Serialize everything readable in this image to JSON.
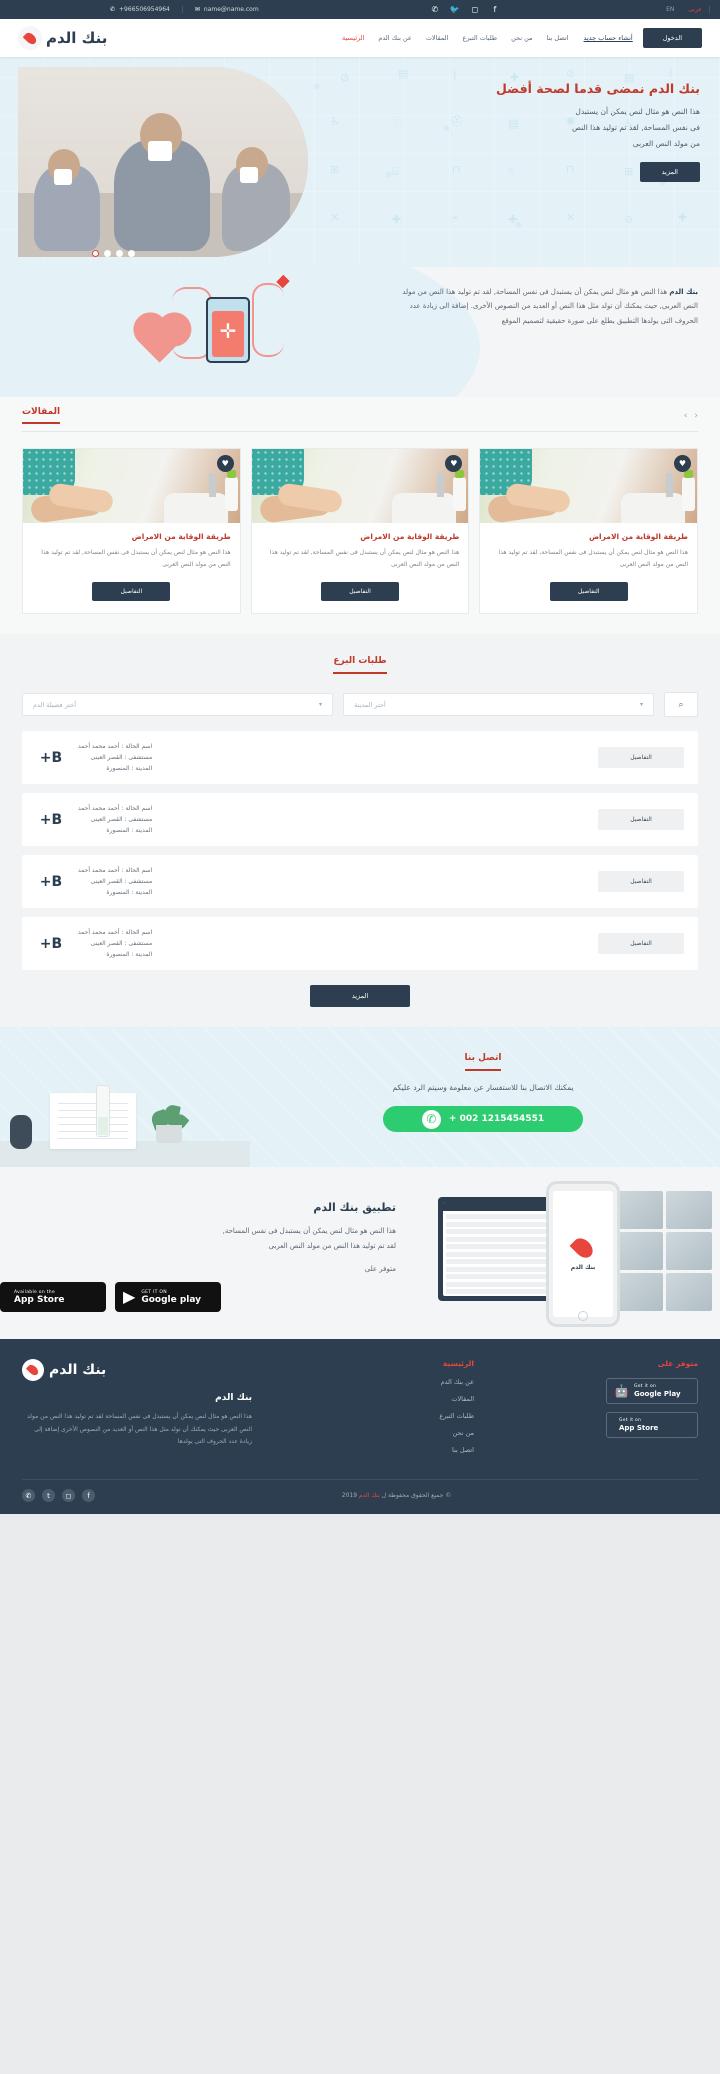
{
  "topbar": {
    "phone": "+966506954964",
    "email": "name@name.com",
    "phone_icon": "phone-icon",
    "email_icon": "envelope-icon",
    "social": [
      "whatsapp-icon",
      "twitter-icon",
      "instagram-icon",
      "facebook-icon"
    ],
    "lang_en": "EN",
    "lang_ar": "عربى"
  },
  "nav": {
    "brand": "بنك الدم",
    "links": [
      {
        "label": "الرئيسية",
        "active": true
      },
      {
        "label": "عن بنك الدم",
        "active": false
      },
      {
        "label": "المقالات",
        "active": false
      },
      {
        "label": "طلبات التبرع",
        "active": false
      },
      {
        "label": "من نحن",
        "active": false
      },
      {
        "label": "اتصل بنا",
        "active": false
      }
    ],
    "register": "أنشاء حساب جديد",
    "login": "الدخول"
  },
  "hero": {
    "title": "بنك الدم نمضى قدما لصحة أفضل",
    "line1": "هذا النص هو مثال لنص يمكن أن يستبدل",
    "line2": "فى نفس المساحة, لقد تم توليد هذا النص",
    "line3": "من مولد النص العربى",
    "button": "المزيد",
    "slides": 4,
    "active_slide": 4
  },
  "about": {
    "strong": "بنك الدم",
    "text": " هذا النص هو مثال لنص يمكن أن يستبدل فى نفس المساحة, لقد تم توليد هذا النص من مولد النص العربى, حيث يمكنك أن تولد مثل هذا النص أو العديد من النصوص الأخرى. إضافة الى زيادة عدد الحروف التى يولدها التطبيق يطلع على صورة حقيقية لتصميم الموقع"
  },
  "articles": {
    "section_title": "المقالات",
    "prev_icon": "chevron-left-icon",
    "next_icon": "chevron-right-icon",
    "items": [
      {
        "title": "طريقة الوقاية من الامراض",
        "text": "هذا النص هو مثال لنص يمكن أن يستبدل فى نفس المساحة, لقد تم توليد هذا النص من مولد النص العربى",
        "button": "التفاصيل",
        "favorite_icon": "heart-icon"
      },
      {
        "title": "طريقة الوقاية من الامراض",
        "text": "هذا النص هو مثال لنص يمكن أن يستبدل فى نفس المساحة, لقد تم توليد هذا النص من مولد النص العربى",
        "button": "التفاصيل",
        "favorite_icon": "heart-icon"
      },
      {
        "title": "طريقة الوقاية من الامراض",
        "text": "هذا النص هو مثال لنص يمكن أن يستبدل فى نفس المساحة, لقد تم توليد هذا النص من مولد النص العربى",
        "button": "التفاصيل",
        "favorite_icon": "heart-icon"
      }
    ]
  },
  "donations": {
    "section_title": "طلبات البرع",
    "filter_blood": "أختر فصيلة الدم",
    "filter_city": "أختر المدينة",
    "search_icon": "search-icon",
    "chevron_icon": "chevron-down-icon",
    "rows": [
      {
        "blood_type": "B+",
        "name": "اسم الحالة : أحمد محمد أحمد",
        "hospital": "مستشفى : القصر العينى",
        "city": "المدينة : المنصورة",
        "button": "التفاصيل"
      },
      {
        "blood_type": "B+",
        "name": "اسم الحالة : أحمد محمد أحمد",
        "hospital": "مستشفى : القصر العينى",
        "city": "المدينة : المنصورة",
        "button": "التفاصيل"
      },
      {
        "blood_type": "B+",
        "name": "اسم الحالة : أحمد محمد أحمد",
        "hospital": "مستشفى : القصر العينى",
        "city": "المدينة : المنصورة",
        "button": "التفاصيل"
      },
      {
        "blood_type": "B+",
        "name": "اسم الحالة : أحمد محمد أحمد",
        "hospital": "مستشفى : القصر العينى",
        "city": "المدينة : المنصورة",
        "button": "التفاصيل"
      }
    ],
    "more_button": "المزيد"
  },
  "contact": {
    "title": "اتصل بنا",
    "subtitle": "يمكنك الاتصال بنا للاستفسار عن معلومة وسيتم الرد عليكم",
    "whatsapp_number": "+ 002 1215454551",
    "whatsapp_icon": "whatsapp-icon"
  },
  "app": {
    "title": "تطبيق بنك الدم",
    "line1": "هذا النص هو مثال لنص يمكن أن يستبدل فى نفس المساحة,",
    "line2": "لقد تم توليد هذا النص من مولد النص العربى",
    "available_label": "متوفر على",
    "appstore_small": "Available on the",
    "appstore_big": "App Store",
    "appstore_icon": "apple-icon",
    "googleplay_small": "GET IT ON",
    "googleplay_big": "Google play",
    "googleplay_icon": "play-icon"
  },
  "footer": {
    "brand": "بنك الدم",
    "heading": "بنك الدم",
    "about_text": "هذا النص هو مثال لنص يمكن أن يستبدل فى نفس المساحة لقد تم توليد هذا النص من مولد النص العربى حيث يمكنك أن تولد مثل هذا النص أو العديد من النصوص الأخرى إضافة إلى زيادة عدد الحروف التى يولدها",
    "col_links_title": "الرئيسية",
    "links": [
      "عن بنك الدم",
      "المقالات",
      "طلبات التبرع",
      "من نحن",
      "اتصل بنا"
    ],
    "col_stores_title": "متوفر على",
    "gp_small": "Get it on",
    "gp_big": "Google Play",
    "gp_icon": "android-icon",
    "as_small": "Get it on",
    "as_big": "App Store",
    "as_icon": "apple-icon",
    "copyright_pre": "جميع الحقوق محفوظة ل",
    "copyright_brand": "بنك الدم",
    "copyright_year": "2019 ©",
    "social": [
      "whatsapp-icon",
      "twitter-icon",
      "instagram-icon",
      "facebook-icon"
    ]
  },
  "colors": {
    "primary_dark": "#2c3e50",
    "accent_red": "#c0392b",
    "light_blue": "#e4f2f7",
    "green": "#2ecc71"
  }
}
